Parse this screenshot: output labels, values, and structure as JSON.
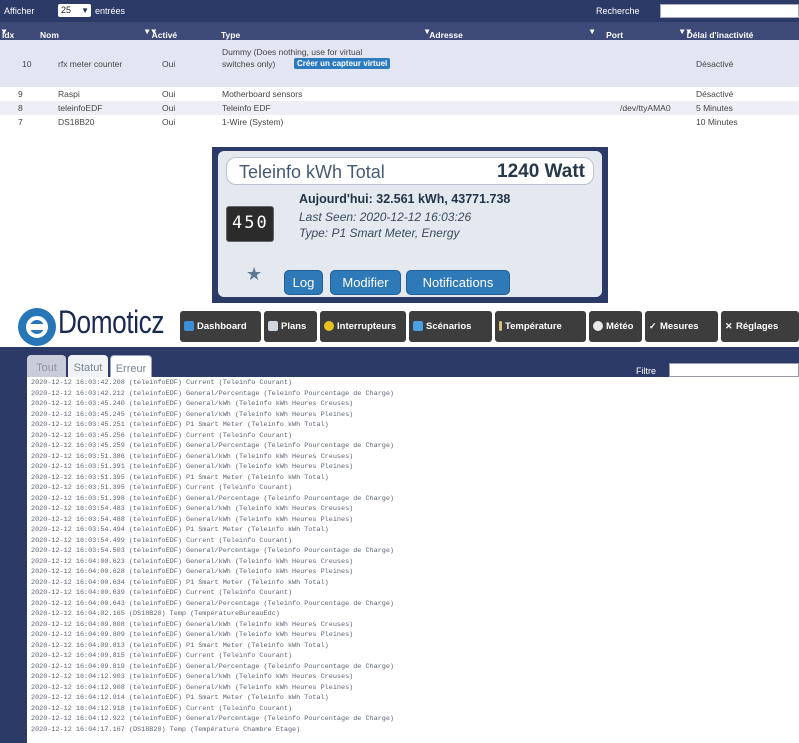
{
  "table": {
    "show_label": "Afficher",
    "show_value": "25",
    "entries_label": "entrées",
    "search_label": "Recherche",
    "columns": [
      "Idx",
      "Nom",
      "Activé",
      "Type",
      "Adresse",
      "Port",
      "Délai d'inactivité"
    ],
    "rows": [
      {
        "idx": "10",
        "name": "rfx meter counter",
        "active": "Oui",
        "type": "Dummy (Does nothing, use for virtual",
        "type2": "switches only)",
        "badge": "Créer un capteur virtuel",
        "port": "",
        "timeout": "Désactivé"
      },
      {
        "idx": "9",
        "name": "Raspi",
        "active": "Oui",
        "type": "Motherboard sensors",
        "port": "",
        "timeout": "Désactivé"
      },
      {
        "idx": "8",
        "name": "teleinfoEDF",
        "active": "Oui",
        "type": "Teleinfo EDF",
        "port": "/dev/ttyAMA0",
        "timeout": "5 Minutes"
      },
      {
        "idx": "7",
        "name": "DS18B20",
        "active": "Oui",
        "type": "1-Wire (System)",
        "port": "",
        "timeout": "10 Minutes"
      }
    ]
  },
  "widget": {
    "name": "Teleinfo kWh Total",
    "value": "1240 Watt",
    "meter_digits": "450",
    "today": "Aujourd'hui: 32.561 kWh, 43771.738",
    "last_seen": "Last Seen: 2020-12-12 16:03:26",
    "type": "Type: P1 Smart Meter, Energy",
    "buttons": [
      "Log",
      "Modifier",
      "Notifications"
    ]
  },
  "app": {
    "brand": "Domoticz",
    "nav": [
      "Dashboard",
      "Plans",
      "Interrupteurs",
      "Scénarios",
      "Température",
      "Météo",
      "Mesures",
      "Réglages"
    ],
    "tabs": [
      "Tout",
      "Statut",
      "Erreur"
    ],
    "filter_label": "Filtre"
  },
  "log": [
    "2020-12-12 16:03:42.208 (teleinfoEDF) Current (Teleinfo Courant)",
    "2020-12-12 16:03:42.212 (teleinfoEDF) General/Percentage (Teleinfo Pourcentage de Charge)",
    "2020-12-12 16:03:45.240 (teleinfoEDF) General/kWh (Teleinfo kWh Heures Creuses)",
    "2020-12-12 16:03:45.245 (teleinfoEDF) General/kWh (Teleinfo kWh Heures Pleines)",
    "2020-12-12 16:03:45.251 (teleinfoEDF) P1 Smart Meter (Teleinfo kWh Total)",
    "2020-12-12 16:03:45.256 (teleinfoEDF) Current (Teleinfo Courant)",
    "2020-12-12 16:03:45.259 (teleinfoEDF) General/Percentage (Teleinfo Pourcentage de Charge)",
    "2020-12-12 16:03:51.386 (teleinfoEDF) General/kWh (Teleinfo kWh Heures Creuses)",
    "2020-12-12 16:03:51.391 (teleinfoEDF) General/kWh (Teleinfo kWh Heures Pleines)",
    "2020-12-12 16:03:51.395 (teleinfoEDF) P1 Smart Meter (Teleinfo kWh Total)",
    "2020-12-12 16:03:51.395 (teleinfoEDF) Current (Teleinfo Courant)",
    "2020-12-12 16:03:51.398 (teleinfoEDF) General/Percentage (Teleinfo Pourcentage de Charge)",
    "2020-12-12 16:03:54.483 (teleinfoEDF) General/kWh (Teleinfo kWh Heures Creuses)",
    "2020-12-12 16:03:54.488 (teleinfoEDF) General/kWh (Teleinfo kWh Heures Pleines)",
    "2020-12-12 16:03:54.494 (teleinfoEDF) P1 Smart Meter (Teleinfo kWh Total)",
    "2020-12-12 16:03:54.499 (teleinfoEDF) Current (Teleinfo Courant)",
    "2020-12-12 16:03:54.503 (teleinfoEDF) General/Percentage (Teleinfo Pourcentage de Charge)",
    "2020-12-12 16:04:00.623 (teleinfoEDF) General/kWh (Teleinfo kWh Heures Creuses)",
    "2020-12-12 16:04:00.628 (teleinfoEDF) General/kWh (Teleinfo kWh Heures Pleines)",
    "2020-12-12 16:04:00.634 (teleinfoEDF) P1 Smart Meter (Teleinfo kWh Total)",
    "2020-12-12 16:04:00.639 (teleinfoEDF) Current (Teleinfo Courant)",
    "2020-12-12 16:04:00.643 (teleinfoEDF) General/Percentage (Teleinfo Pourcentage de Charge)",
    "2020-12-12 16:04:02.165 (DS18B20) Temp (TempératureBureauEdc)",
    "2020-12-12 16:04:09.808 (teleinfoEDF) General/kWh (Teleinfo kWh Heures Creuses)",
    "2020-12-12 16:04:09.809 (teleinfoEDF) General/kWh (Teleinfo kWh Heures Pleines)",
    "2020-12-12 16:04:09.813 (teleinfoEDF) P1 Smart Meter (Teleinfo kWh Total)",
    "2020-12-12 16:04:09.815 (teleinfoEDF) Current (Teleinfo Courant)",
    "2020-12-12 16:04:09.819 (teleinfoEDF) General/Percentage (Teleinfo Pourcentage de Charge)",
    "2020-12-12 16:04:12.903 (teleinfoEDF) General/kWh (Teleinfo kWh Heures Creuses)",
    "2020-12-12 16:04:12.908 (teleinfoEDF) General/kWh (Teleinfo kWh Heures Pleines)",
    "2020-12-12 16:04:12.914 (teleinfoEDF) P1 Smart Meter (Teleinfo kWh Total)",
    "2020-12-12 16:04:12.918 (teleinfoEDF) Current (Teleinfo Courant)",
    "2020-12-12 16:04:12.922 (teleinfoEDF) General/Percentage (Teleinfo Pourcentage de Charge)",
    "2020-12-12 16:04:17.167 (DS18B20) Temp (Température Chambre Etage)"
  ]
}
